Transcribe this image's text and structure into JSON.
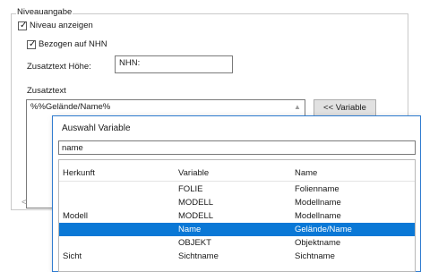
{
  "group": {
    "title": "Niveauangabe",
    "show_level_label": "Niveau anzeigen",
    "show_level_checked": true,
    "relative_nhn_label": "Bezogen auf NHN",
    "relative_nhn_checked": true,
    "height_text_label": "Zusatztext Höhe:",
    "height_text_value": "NHN:",
    "additional_text_label": "Zusatztext",
    "additional_text_value": "%%Gelände/Name%",
    "variable_button": "<< Variable"
  },
  "popup": {
    "title": "Auswahl Variable",
    "search_value": "name",
    "columns": [
      "Herkunft",
      "Variable",
      "Name"
    ],
    "rows": [
      {
        "origin": "",
        "variable": "FOLIE",
        "name": "Folienname",
        "selected": false
      },
      {
        "origin": "",
        "variable": "MODELL",
        "name": "Modellname",
        "selected": false
      },
      {
        "origin": "Modell",
        "variable": "MODELL",
        "name": "Modellname",
        "selected": false
      },
      {
        "origin": "",
        "variable": "Name",
        "name": "Gelände/Name",
        "selected": true
      },
      {
        "origin": "",
        "variable": "OBJEKT",
        "name": "Objektname",
        "selected": false
      },
      {
        "origin": "Sicht",
        "variable": "Sichtname",
        "name": "Sichtname",
        "selected": false
      }
    ]
  },
  "colors": {
    "selection": "#0a78d6",
    "popup_border": "#2e7bcf"
  }
}
